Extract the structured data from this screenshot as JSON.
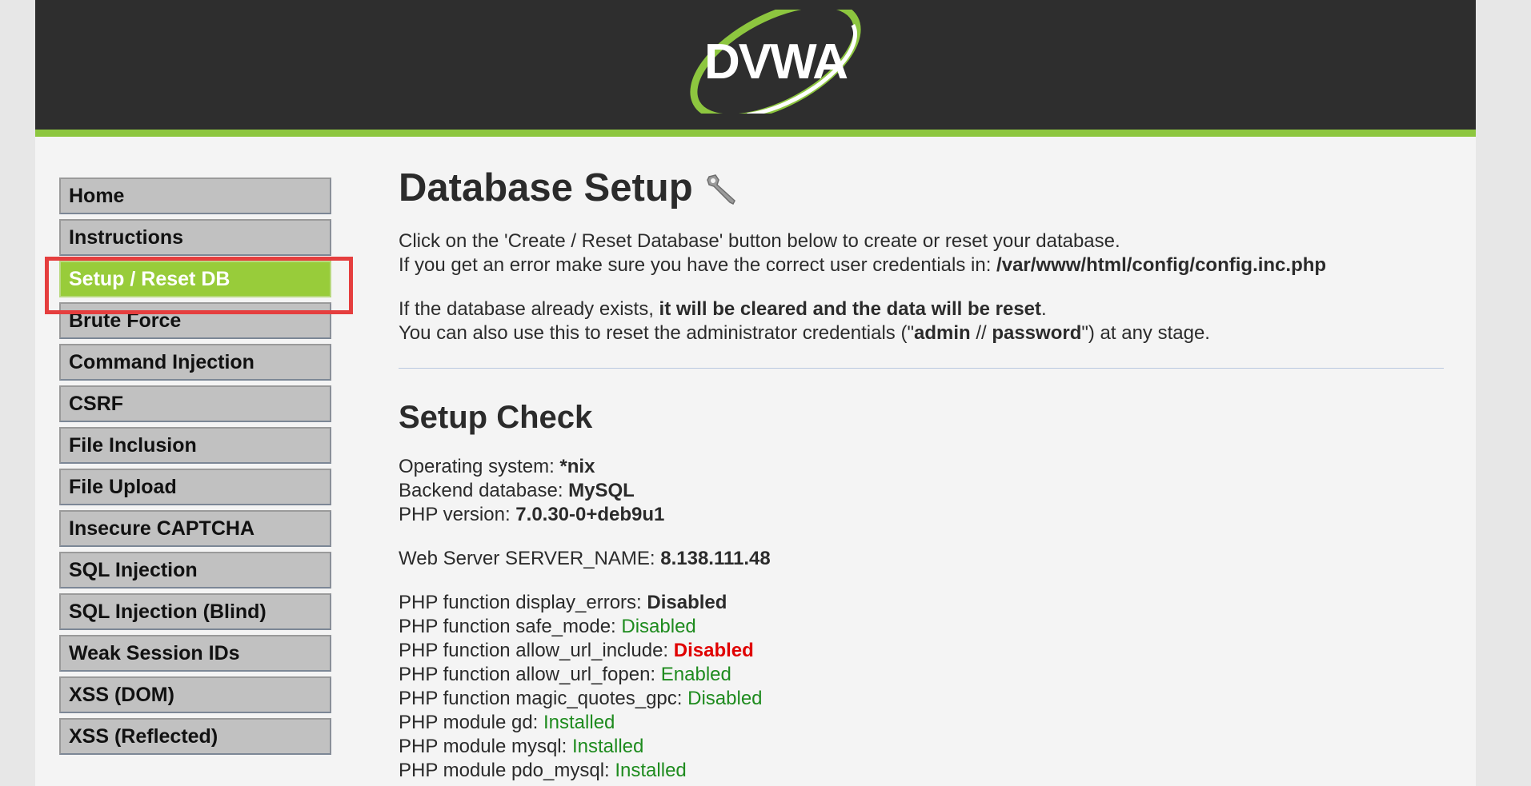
{
  "header": {
    "logo_text": "DVWA"
  },
  "menu": {
    "group1": [
      {
        "label": "Home"
      },
      {
        "label": "Instructions"
      },
      {
        "label": "Setup / Reset DB"
      }
    ],
    "group2": [
      {
        "label": "Brute Force"
      },
      {
        "label": "Command Injection"
      },
      {
        "label": "CSRF"
      },
      {
        "label": "File Inclusion"
      },
      {
        "label": "File Upload"
      },
      {
        "label": "Insecure CAPTCHA"
      },
      {
        "label": "SQL Injection"
      },
      {
        "label": "SQL Injection (Blind)"
      },
      {
        "label": "Weak Session IDs"
      },
      {
        "label": "XSS (DOM)"
      },
      {
        "label": "XSS (Reflected)"
      }
    ]
  },
  "main": {
    "title": "Database Setup",
    "intro_line1": "Click on the 'Create / Reset Database' button below to create or reset your database.",
    "intro_line2_prefix": "If you get an error make sure you have the correct user credentials in: ",
    "config_path": "/var/www/html/config/config.inc.php",
    "warn_prefix": "If the database already exists, ",
    "warn_bold": "it will be cleared and the data will be reset",
    "warn_suffix": ".",
    "reset_prefix": "You can also use this to reset the administrator credentials (\"",
    "reset_admin": "admin",
    "reset_sep": " // ",
    "reset_password": "password",
    "reset_suffix": "\") at any stage.",
    "check_title": "Setup Check",
    "os_label": "Operating system: ",
    "os_value": "*nix",
    "db_label": "Backend database: ",
    "db_value": "MySQL",
    "php_label": "PHP version: ",
    "php_value": "7.0.30-0+deb9u1",
    "server_label": "Web Server SERVER_NAME: ",
    "server_value": "8.138.111.48",
    "checks": [
      {
        "label": "PHP function display_errors: ",
        "value": "Disabled",
        "status": "bold"
      },
      {
        "label": "PHP function safe_mode: ",
        "value": "Disabled",
        "status": "green"
      },
      {
        "label": "PHP function allow_url_include: ",
        "value": "Disabled",
        "status": "red"
      },
      {
        "label": "PHP function allow_url_fopen: ",
        "value": "Enabled",
        "status": "green"
      },
      {
        "label": "PHP function magic_quotes_gpc: ",
        "value": "Disabled",
        "status": "green"
      },
      {
        "label": "PHP module gd: ",
        "value": "Installed",
        "status": "green"
      },
      {
        "label": "PHP module mysql: ",
        "value": "Installed",
        "status": "green"
      },
      {
        "label": "PHP module pdo_mysql: ",
        "value": "Installed",
        "status": "green"
      }
    ]
  },
  "colors": {
    "ok": "#1e8b1e",
    "bad": "#e00000",
    "accent": "#8dc63f"
  }
}
